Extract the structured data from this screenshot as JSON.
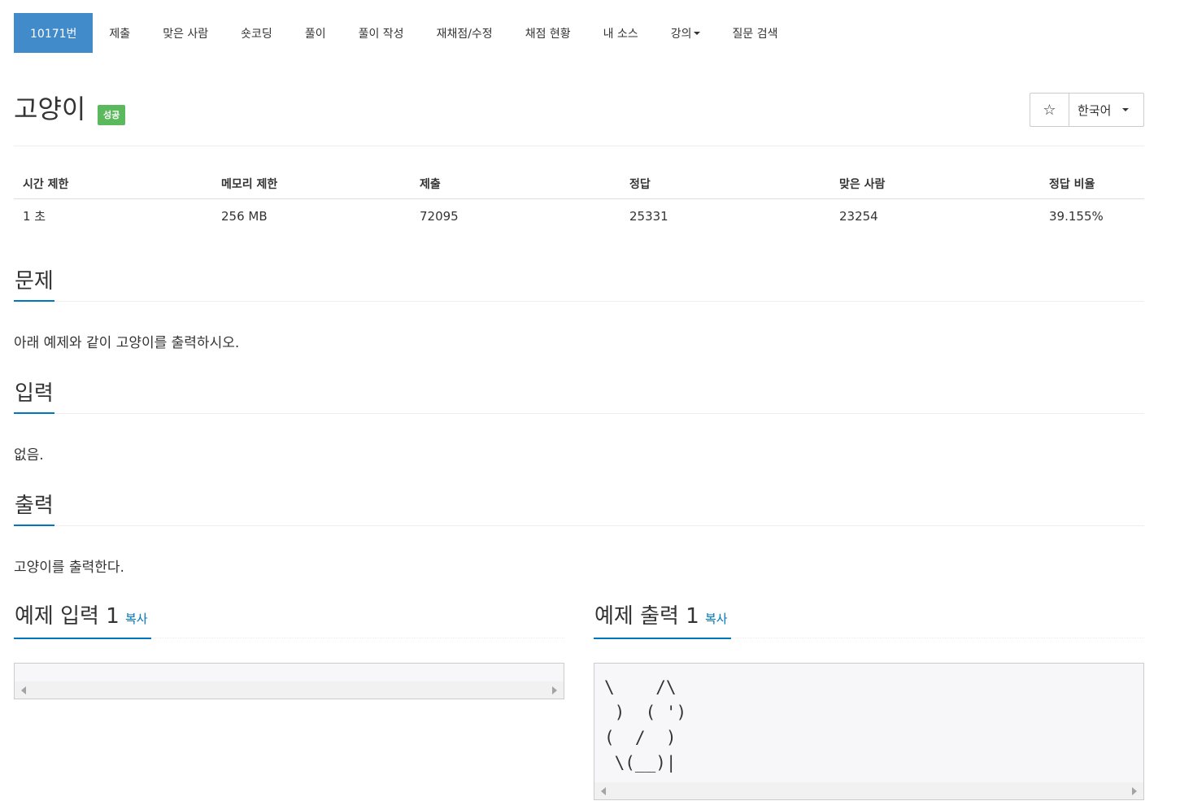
{
  "nav": {
    "items": [
      {
        "label": "10171번",
        "active": true
      },
      {
        "label": "제출"
      },
      {
        "label": "맞은 사람"
      },
      {
        "label": "숏코딩"
      },
      {
        "label": "풀이"
      },
      {
        "label": "풀이 작성"
      },
      {
        "label": "재채점/수정"
      },
      {
        "label": "채점 현황"
      },
      {
        "label": "내 소스"
      },
      {
        "label": "강의"
      },
      {
        "label": "질문 검색"
      }
    ]
  },
  "problem": {
    "title": "고양이",
    "badge": "성공",
    "star": "☆",
    "language": "한국어"
  },
  "stats": {
    "headers": [
      "시간 제한",
      "메모리 제한",
      "제출",
      "정답",
      "맞은 사람",
      "정답 비율"
    ],
    "values": [
      "1 초",
      "256 MB",
      "72095",
      "25331",
      "23254",
      "39.155%"
    ]
  },
  "sections": {
    "description_title": "문제",
    "description": "아래 예제와 같이 고양이를 출력하시오.",
    "input_title": "입력",
    "input": "없음.",
    "output_title": "출력",
    "output": "고양이를 출력한다."
  },
  "samples": {
    "input_title": "예제 입력 1",
    "output_title": "예제 출력 1",
    "copy_label": "복사",
    "input_text": "",
    "output_text": "\\    /\\\n )  ( ')\n(  /  )\n \\(__)|"
  },
  "colors": {
    "accent": "#428bca",
    "link": "#0076c0",
    "success": "#5cb85c"
  },
  "icons": {
    "star": "star-icon",
    "caret": "chevron-down-icon"
  }
}
